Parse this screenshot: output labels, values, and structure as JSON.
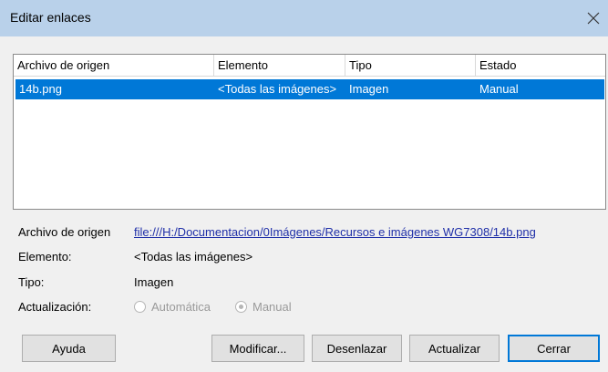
{
  "dialog": {
    "title": "Editar enlaces"
  },
  "table": {
    "columns": [
      "Archivo de origen",
      "Elemento",
      "Tipo",
      "Estado"
    ],
    "rows": [
      {
        "source": "14b.png",
        "element": "<Todas las imágenes>",
        "type": "Imagen",
        "status": "Manual",
        "selected": true
      }
    ]
  },
  "details": {
    "source_label": "Archivo de origen",
    "source_value": "file:///H:/Documentacion/0Imágenes/Recursos e imágenes WG7308/14b.png",
    "element_label": "Elemento:",
    "element_value": "<Todas las imágenes>",
    "type_label": "Tipo:",
    "type_value": "Imagen",
    "update_label": "Actualización:",
    "update_options": [
      {
        "label": "Automática",
        "selected": false,
        "enabled": false
      },
      {
        "label": "Manual",
        "selected": true,
        "enabled": false
      }
    ]
  },
  "buttons": {
    "help": "Ayuda",
    "modify": "Modificar...",
    "unlink": "Desenlazar",
    "update": "Actualizar",
    "close": "Cerrar"
  },
  "colors": {
    "titlebar": "#b9d1ea",
    "selection": "#0078d7",
    "link": "#1f2fa8"
  }
}
